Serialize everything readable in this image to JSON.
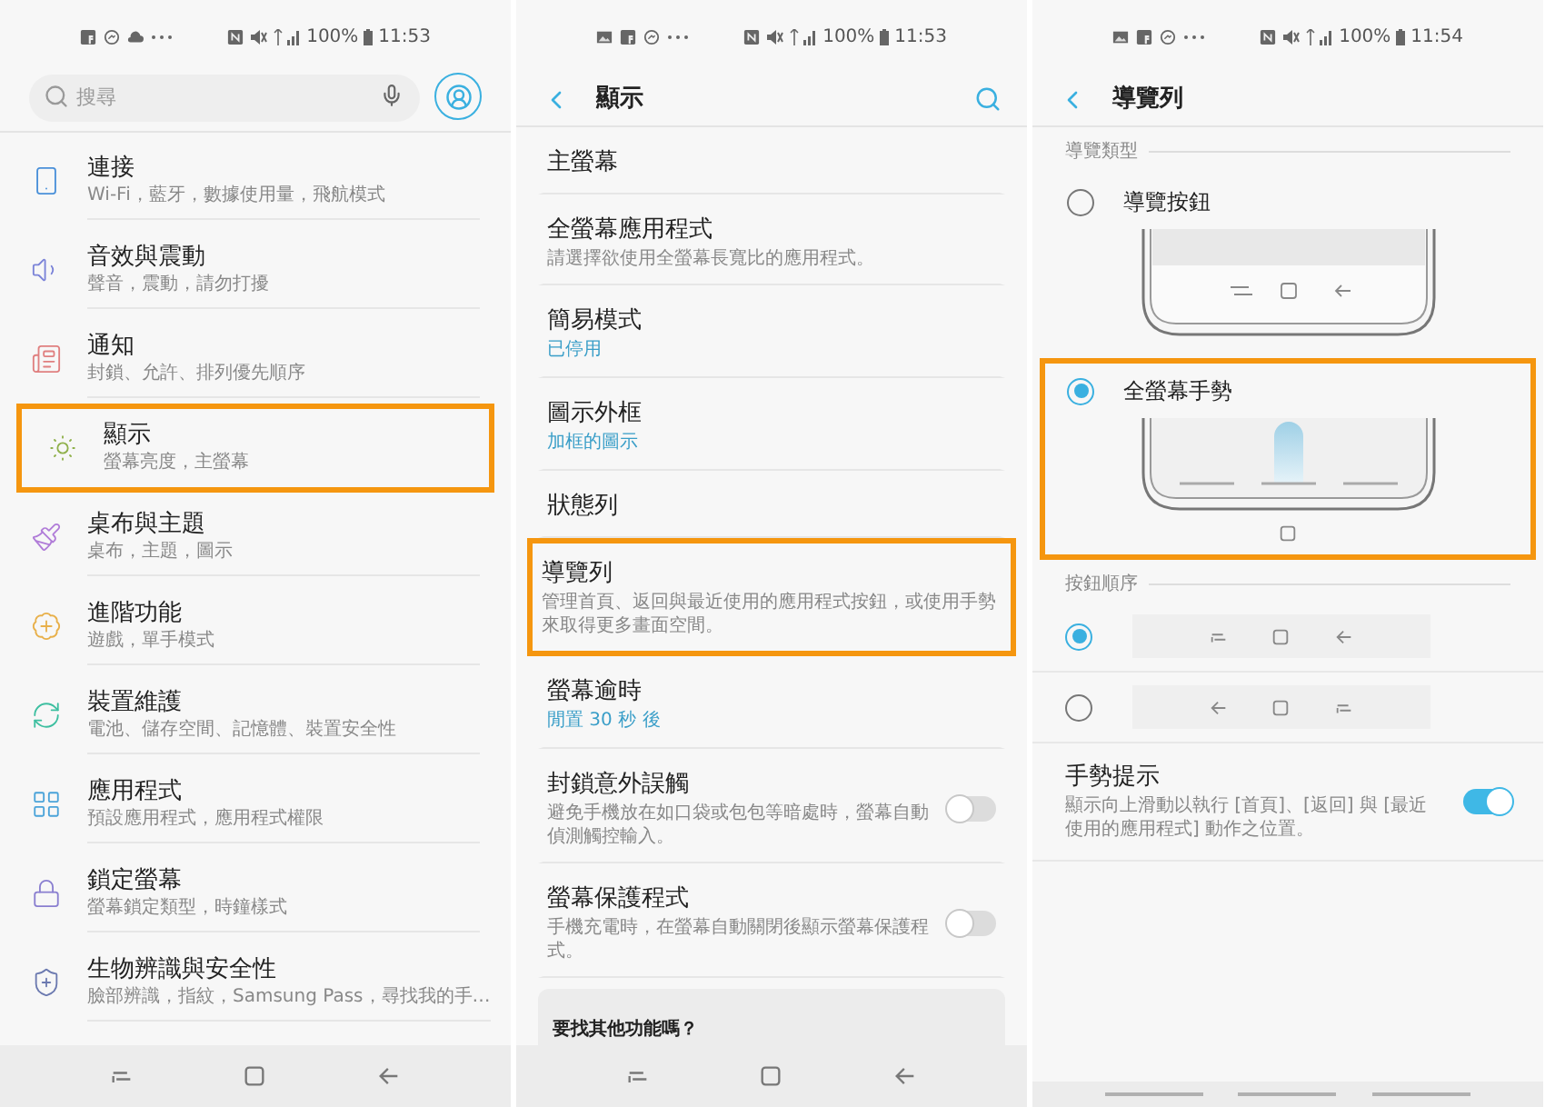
{
  "panels": [
    {
      "kind": "home",
      "status_bar": {
        "battery": "100%",
        "time": "11:53"
      },
      "search": {
        "placeholder": "搜尋"
      },
      "items": [
        {
          "title": "連接",
          "subtitle": "Wi-Fi，藍牙，數據使用量，飛航模式",
          "color": "#4a90d9",
          "highlighted": false
        },
        {
          "title": "音效與震動",
          "subtitle": "聲音，震動，請勿打擾",
          "color": "#7b83d8",
          "highlighted": false
        },
        {
          "title": "通知",
          "subtitle": "封鎖、允許、排列優先順序",
          "color": "#e08080",
          "highlighted": false
        },
        {
          "title": "顯示",
          "subtitle": "螢幕亮度，主螢幕",
          "color": "#8fb04a",
          "highlighted": true
        },
        {
          "title": "桌布與主題",
          "subtitle": "桌布，主題，圖示",
          "color": "#b07cd8",
          "highlighted": false
        },
        {
          "title": "進階功能",
          "subtitle": "遊戲，單手模式",
          "color": "#e8b04a",
          "highlighted": false
        },
        {
          "title": "裝置維護",
          "subtitle": "電池、儲存空間、記憶體、裝置安全性",
          "color": "#3dbfa0",
          "highlighted": false
        },
        {
          "title": "應用程式",
          "subtitle": "預設應用程式，應用程式權限",
          "color": "#4aa3d9",
          "highlighted": false
        },
        {
          "title": "鎖定螢幕",
          "subtitle": "螢幕鎖定類型，時鐘樣式",
          "color": "#8a7fd0",
          "highlighted": false
        },
        {
          "title": "生物辨識與安全性",
          "subtitle": "臉部辨識，指紋，Samsung Pass，尋找我的手…",
          "color": "#6c7ab0",
          "highlighted": false
        }
      ],
      "nav_bar": {
        "kind": "buttons"
      }
    },
    {
      "kind": "display",
      "status_bar": {
        "battery": "100%",
        "time": "11:53"
      },
      "header": {
        "title": "顯示"
      },
      "items": [
        {
          "title": "主螢幕",
          "highlighted": false
        },
        {
          "title": "全螢幕應用程式",
          "subtitle": "請選擇欲使用全螢幕長寬比的應用程式。",
          "highlighted": false
        },
        {
          "title": "簡易模式",
          "value": "已停用",
          "highlighted": false
        },
        {
          "title": "圖示外框",
          "value": "加框的圖示",
          "highlighted": false
        },
        {
          "title": "狀態列",
          "highlighted": false
        },
        {
          "title": "導覽列",
          "subtitle": "管理首頁、返回與最近使用的應用程式按鈕，或使用手勢來取得更多畫面空間。",
          "highlighted": true
        },
        {
          "title": "螢幕逾時",
          "value": "閒置 30 秒 後",
          "highlighted": false
        },
        {
          "title": "封鎖意外誤觸",
          "subtitle": "避免手機放在如口袋或包包等暗處時，螢幕自動偵測觸控輸入。",
          "highlighted": false,
          "toggle": {
            "on": false
          }
        },
        {
          "title": "螢幕保護程式",
          "subtitle": "手機充電時，在螢幕自動關閉後顯示螢幕保護程式。",
          "highlighted": false,
          "toggle": {
            "on": false
          }
        }
      ],
      "card": {
        "title": "要找其他功能嗎？"
      },
      "nav_bar": {
        "kind": "buttons"
      }
    },
    {
      "kind": "navigation",
      "status_bar": {
        "battery": "100%",
        "time": "11:54"
      },
      "header": {
        "title": "導覽列"
      },
      "nav_type": {
        "label": "導覽類型",
        "options": [
          {
            "kind": "buttons",
            "label": "導覽按鈕",
            "selected": false,
            "highlighted": false
          },
          {
            "kind": "gesture",
            "label": "全螢幕手勢",
            "selected": true,
            "highlighted": true
          }
        ]
      },
      "button_order": {
        "label": "按鈕順序",
        "options": [
          {
            "kind": "recents_first",
            "selected": true
          },
          {
            "kind": "back_first",
            "selected": false
          }
        ]
      },
      "gesture_hint": {
        "title": "手勢提示",
        "description": "顯示向上滑動以執行 [首頁]、[返回] 與 [最近使用的應用程式] 動作之位置。",
        "on": true
      },
      "nav_bar": {
        "kind": "gesture"
      }
    }
  ]
}
